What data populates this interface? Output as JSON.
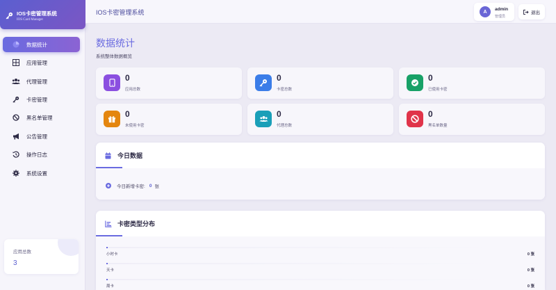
{
  "brand": {
    "title": "IOS卡密管理系统",
    "subtitle": "IOS Card Manager"
  },
  "nav": [
    {
      "label": "数据统计",
      "icon": "chart-pie-icon",
      "active": true
    },
    {
      "label": "应用管理",
      "icon": "grid-icon"
    },
    {
      "label": "代理管理",
      "icon": "users-icon"
    },
    {
      "label": "卡密管理",
      "icon": "key-icon"
    },
    {
      "label": "黑名单管理",
      "icon": "ban-icon"
    },
    {
      "label": "公告管理",
      "icon": "megaphone-icon"
    },
    {
      "label": "操作日志",
      "icon": "history-icon"
    },
    {
      "label": "系统设置",
      "icon": "gear-icon"
    }
  ],
  "side_card": {
    "label": "应用总数",
    "value": "3"
  },
  "header": {
    "title": "IOS卡密管理系统",
    "avatar_letter": "A",
    "user_name": "admin",
    "user_role": "管理员",
    "logout_label": "退出"
  },
  "page": {
    "title": "数据统计",
    "subtitle": "系统整体数据概览"
  },
  "stats": [
    {
      "value": "0",
      "label": "应用总数",
      "icon": "mobile-icon",
      "color": "#8b4fe0"
    },
    {
      "value": "0",
      "label": "卡密总数",
      "icon": "key-icon",
      "color": "#3b7de8"
    },
    {
      "value": "0",
      "label": "已使用卡密",
      "icon": "check-circle-icon",
      "color": "#18a167"
    },
    {
      "value": "0",
      "label": "未使用卡密",
      "icon": "gift-icon",
      "color": "#e4860f"
    },
    {
      "value": "0",
      "label": "代理总数",
      "icon": "users-icon",
      "color": "#1a9fb8"
    },
    {
      "value": "0",
      "label": "黑名单数量",
      "icon": "ban-icon",
      "color": "#e0344a"
    }
  ],
  "today": {
    "title": "今日数据",
    "row_label": "今日新增卡密:",
    "row_value": "0",
    "row_unit": "张"
  },
  "distribution": {
    "title": "卡密类型分布",
    "rows": [
      {
        "name": "小时卡",
        "count": "0 张"
      },
      {
        "name": "天卡",
        "count": "0 张"
      },
      {
        "name": "周卡",
        "count": "0 张"
      }
    ]
  },
  "colors": {
    "accent": "#6a6be0",
    "brand_gradient_start": "#5b5fd0",
    "brand_gradient_end": "#7b56c4"
  }
}
